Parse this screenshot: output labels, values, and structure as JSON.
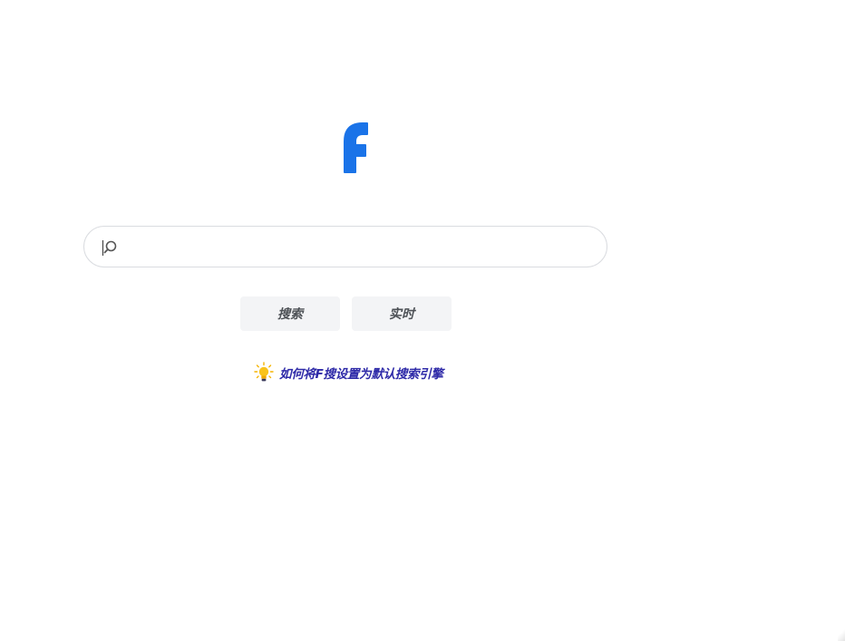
{
  "logo": {
    "icon": "f-logo-icon",
    "color": "#1a73e8"
  },
  "search": {
    "value": "",
    "placeholder": "",
    "icon": "search-icon"
  },
  "buttons": {
    "search_label": "搜索",
    "realtime_label": "实时"
  },
  "tip": {
    "icon": "lightbulb-icon",
    "text": "如何将F搜设置为默认搜索引擎",
    "color": "#2e2aa8"
  }
}
